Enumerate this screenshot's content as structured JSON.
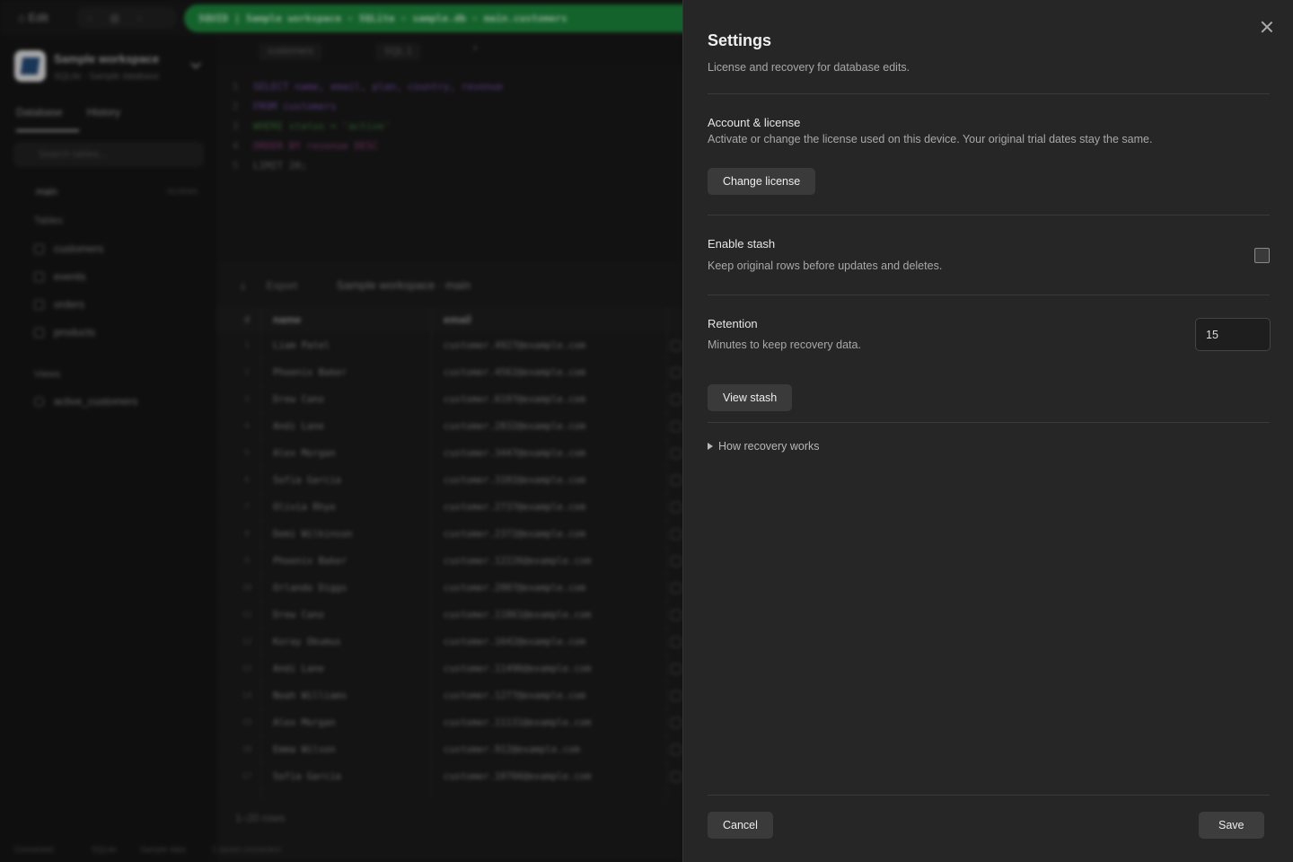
{
  "background": {
    "topbar": {
      "edit_label": "Edit",
      "path_pill": "SQUID | Sample workspace - SQLite - sample.db - main.customers"
    },
    "sidebar": {
      "workspace_name": "Sample workspace",
      "workspace_sub": "SQLite · Sample database",
      "tabs": [
        "Database",
        "History"
      ],
      "search_placeholder": "Search tables...",
      "schema": "main",
      "schema_badge": "SCHEMA",
      "tables_group": "Tables",
      "tables": [
        "customers",
        "events",
        "orders",
        "products"
      ],
      "views_group": "Views",
      "views": [
        "active_customers"
      ]
    },
    "editor": {
      "tabs": [
        "customers",
        "SQL 1"
      ],
      "code": [
        "SELECT name, email, plan, country, revenue",
        "FROM customers",
        "WHERE status = 'active'",
        "ORDER BY revenue DESC",
        "LIMIT 20;"
      ]
    },
    "results": {
      "export_label": "Export",
      "workspace_label": "Sample workspace · main",
      "columns": [
        "name",
        "email"
      ],
      "rows": [
        [
          "Liam Patel",
          "customer.4927@example.com"
        ],
        [
          "Phoenix Baker",
          "customer.4562@example.com"
        ],
        [
          "Drew Cano",
          "customer.6197@example.com"
        ],
        [
          "Andi Lane",
          "customer.2832@example.com"
        ],
        [
          "Alex Morgan",
          "customer.3447@example.com"
        ],
        [
          "Sofia Garcia",
          "customer.3102@example.com"
        ],
        [
          "Olivia Rhye",
          "customer.2737@example.com"
        ],
        [
          "Demi Wilkinson",
          "customer.2372@example.com"
        ],
        [
          "Phoenix Baker",
          "customer.12226@example.com"
        ],
        [
          "Orlando Diggs",
          "customer.2007@example.com"
        ],
        [
          "Drew Cano",
          "customer.11861@example.com"
        ],
        [
          "Koray Okumus",
          "customer.1642@example.com"
        ],
        [
          "Andi Lane",
          "customer.11496@example.com"
        ],
        [
          "Noah Williams",
          "customer.1277@example.com"
        ],
        [
          "Alex Morgan",
          "customer.11131@example.com"
        ],
        [
          "Emma Wilson",
          "customer.912@example.com"
        ],
        [
          "Sofia Garcia",
          "customer.10766@example.com"
        ]
      ],
      "footer": "1–20 rows"
    },
    "statusbar": [
      "Connected",
      "SQLite",
      "Sample data",
      "1 saved connection"
    ]
  },
  "settings": {
    "title": "Settings",
    "subtitle": "License and recovery for database edits.",
    "account": {
      "title": "Account & license",
      "description": "Activate or change the license used on this device. Your original trial dates stay the same.",
      "button": "Change license"
    },
    "stash": {
      "title": "Enable stash",
      "description": "Keep original rows before updates and deletes.",
      "checked": false
    },
    "retention": {
      "title": "Retention",
      "description": "Minutes to keep recovery data.",
      "value": "15",
      "button": "View stash"
    },
    "details_summary": "How recovery works",
    "footer": {
      "cancel": "Cancel",
      "save": "Save"
    }
  }
}
